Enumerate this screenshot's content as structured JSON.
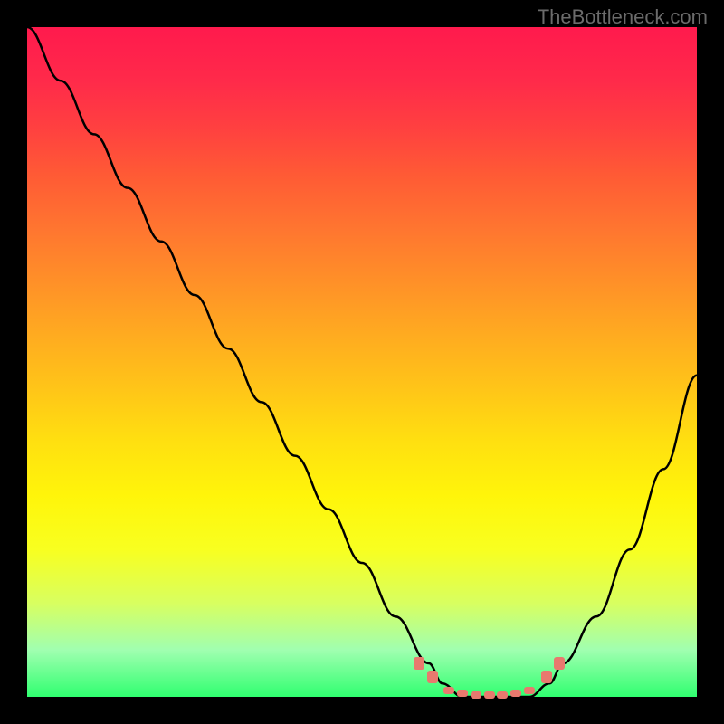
{
  "watermark": "TheBottleneck.com",
  "chart_data": {
    "type": "line",
    "title": "",
    "xlabel": "",
    "ylabel": "",
    "xlim": [
      0,
      100
    ],
    "ylim": [
      0,
      100
    ],
    "series": [
      {
        "name": "bottleneck-curve",
        "x": [
          0,
          5,
          10,
          15,
          20,
          25,
          30,
          35,
          40,
          45,
          50,
          55,
          60,
          62,
          65,
          70,
          75,
          78,
          80,
          85,
          90,
          95,
          100
        ],
        "y": [
          100,
          92,
          84,
          76,
          68,
          60,
          52,
          44,
          36,
          28,
          20,
          12,
          5,
          2,
          0,
          0,
          0,
          2,
          5,
          12,
          22,
          34,
          48
        ]
      }
    ],
    "optimal_zone": {
      "x_start": 62,
      "x_end": 78
    },
    "gradient": {
      "top_color": "#ff1a4d",
      "mid_color": "#ffe010",
      "bottom_color": "#30ff70"
    },
    "markers": [
      {
        "x": 58.5,
        "y": 5
      },
      {
        "x": 60.5,
        "y": 3
      },
      {
        "x": 63,
        "y": 1
      },
      {
        "x": 65,
        "y": 0.5
      },
      {
        "x": 67,
        "y": 0.3
      },
      {
        "x": 69,
        "y": 0.3
      },
      {
        "x": 71,
        "y": 0.3
      },
      {
        "x": 73,
        "y": 0.5
      },
      {
        "x": 75,
        "y": 1
      },
      {
        "x": 77.5,
        "y": 3
      },
      {
        "x": 79.5,
        "y": 5
      }
    ]
  }
}
